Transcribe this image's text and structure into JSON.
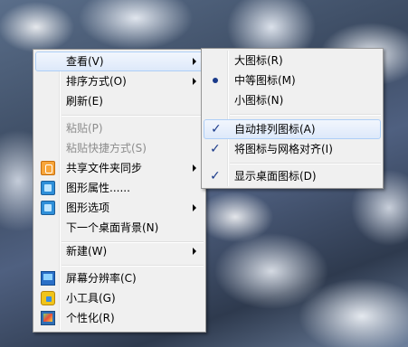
{
  "main_menu": {
    "view": "查看(V)",
    "sort_by": "排序方式(O)",
    "refresh": "刷新(E)",
    "paste": "粘贴(P)",
    "paste_shortcut": "粘贴快捷方式(S)",
    "share_sync": "共享文件夹同步",
    "graphics_properties": "图形属性......",
    "graphics_options": "图形选项",
    "next_background": "下一个桌面背景(N)",
    "new": "新建(W)",
    "screen_resolution": "屏幕分辨率(C)",
    "gadgets": "小工具(G)",
    "personalize": "个性化(R)"
  },
  "view_submenu": {
    "large_icons": "大图标(R)",
    "medium_icons": "中等图标(M)",
    "small_icons": "小图标(N)",
    "auto_arrange": "自动排列图标(A)",
    "align_to_grid": "将图标与网格对齐(I)",
    "show_desktop_icons": "显示桌面图标(D)"
  },
  "icons": {
    "share_sync": "share-sync-icon",
    "graphics_properties": "graphics-properties-icon",
    "graphics_options": "graphics-options-icon",
    "screen_resolution": "monitor-icon",
    "gadgets": "gadgets-icon",
    "personalize": "personalize-icon"
  },
  "state": {
    "selected_icon_size": "medium_icons",
    "auto_arrange_checked": true,
    "align_to_grid_checked": true,
    "show_desktop_icons_checked": true
  },
  "colors": {
    "menu_background": "#f0f0f0",
    "hover_border": "#aecff7",
    "check_mark": "#1a3a8a"
  }
}
